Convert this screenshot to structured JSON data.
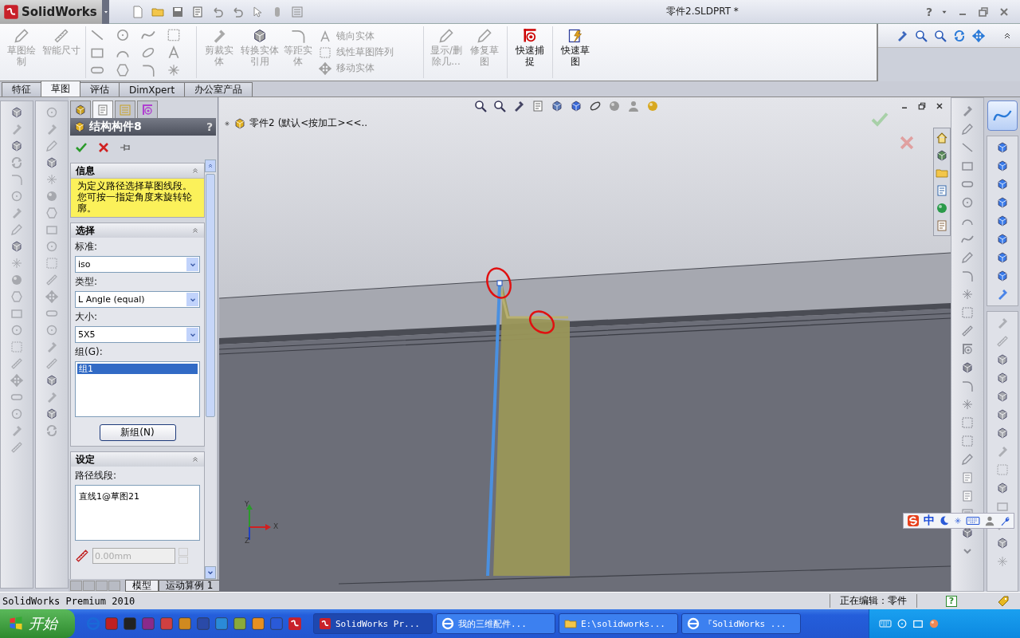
{
  "title_bar": {
    "app_name": "SolidWorks",
    "document_title": "零件2.SLDPRT *",
    "help": "?"
  },
  "ribbon": {
    "items": [
      {
        "label": "草图绘制",
        "disabled": true
      },
      {
        "label": "智能尺寸",
        "disabled": true
      },
      {
        "label": "剪裁实体",
        "disabled": true
      },
      {
        "label": "转换实体引用",
        "disabled": true
      },
      {
        "label": "等距实体",
        "disabled": true
      },
      {
        "label": "镜向实体",
        "disabled": true
      },
      {
        "label": "线性草图阵列",
        "disabled": true
      },
      {
        "label": "移动实体",
        "disabled": true
      },
      {
        "label": "显示/删除几...",
        "disabled": true
      },
      {
        "label": "修复草图",
        "disabled": true
      },
      {
        "label": "快速捕捉",
        "disabled": false
      },
      {
        "label": "快速草图",
        "disabled": false
      }
    ]
  },
  "command_tabs": [
    {
      "label": "特征",
      "selected": false
    },
    {
      "label": "草图",
      "selected": true
    },
    {
      "label": "评估",
      "selected": false
    },
    {
      "label": "DimXpert",
      "selected": false
    },
    {
      "label": "办公室产品",
      "selected": false
    }
  ],
  "property_manager": {
    "tabs": [
      {
        "selected": false
      },
      {
        "selected": true
      },
      {
        "selected": false
      },
      {
        "selected": false
      }
    ],
    "title": "结构构件8",
    "help": "?",
    "info": {
      "title": "信息",
      "message": "为定义路径选择草图线段。您可按一指定角度来旋转轮廓。"
    },
    "selection": {
      "title": "选择",
      "fields": [
        {
          "label": "标准:",
          "value": "iso"
        },
        {
          "label": "类型:",
          "value": "L Angle (equal)"
        },
        {
          "label": "大小:",
          "value": "5X5"
        }
      ],
      "group_label": "组(G):",
      "groups": [
        {
          "label": "组1",
          "selected": true
        }
      ],
      "new_group_button": "新组(N)"
    },
    "settings": {
      "title": "设定",
      "path_label": "路径线段:",
      "path_segments": [
        "直线1@草图21"
      ],
      "rotation": {
        "placeholder": "0.00mm",
        "disabled": true
      }
    },
    "bottom_tabs": [
      {
        "label": "模型",
        "selected": true
      },
      {
        "label": "运动算例 1",
        "selected": false
      }
    ]
  },
  "viewport": {
    "breadcrumb": "零件2",
    "configuration": "(默认<按加工><<..",
    "triad": {
      "x": "X",
      "y": "Y",
      "z": "Z"
    }
  },
  "ime_bar": {
    "mode": "中"
  },
  "status_bar": {
    "product": "SolidWorks Premium 2010",
    "mode": "正在编辑：零件",
    "help": "?"
  },
  "taskbar": {
    "start": "开始",
    "tasks": [
      {
        "label": "SolidWorks Pr...",
        "selected": true
      },
      {
        "label": "我的三维配件...",
        "selected": false
      },
      {
        "label": "E:\\solidworks...",
        "selected": false
      },
      {
        "label": "『SolidWorks ...",
        "selected": false
      }
    ]
  }
}
